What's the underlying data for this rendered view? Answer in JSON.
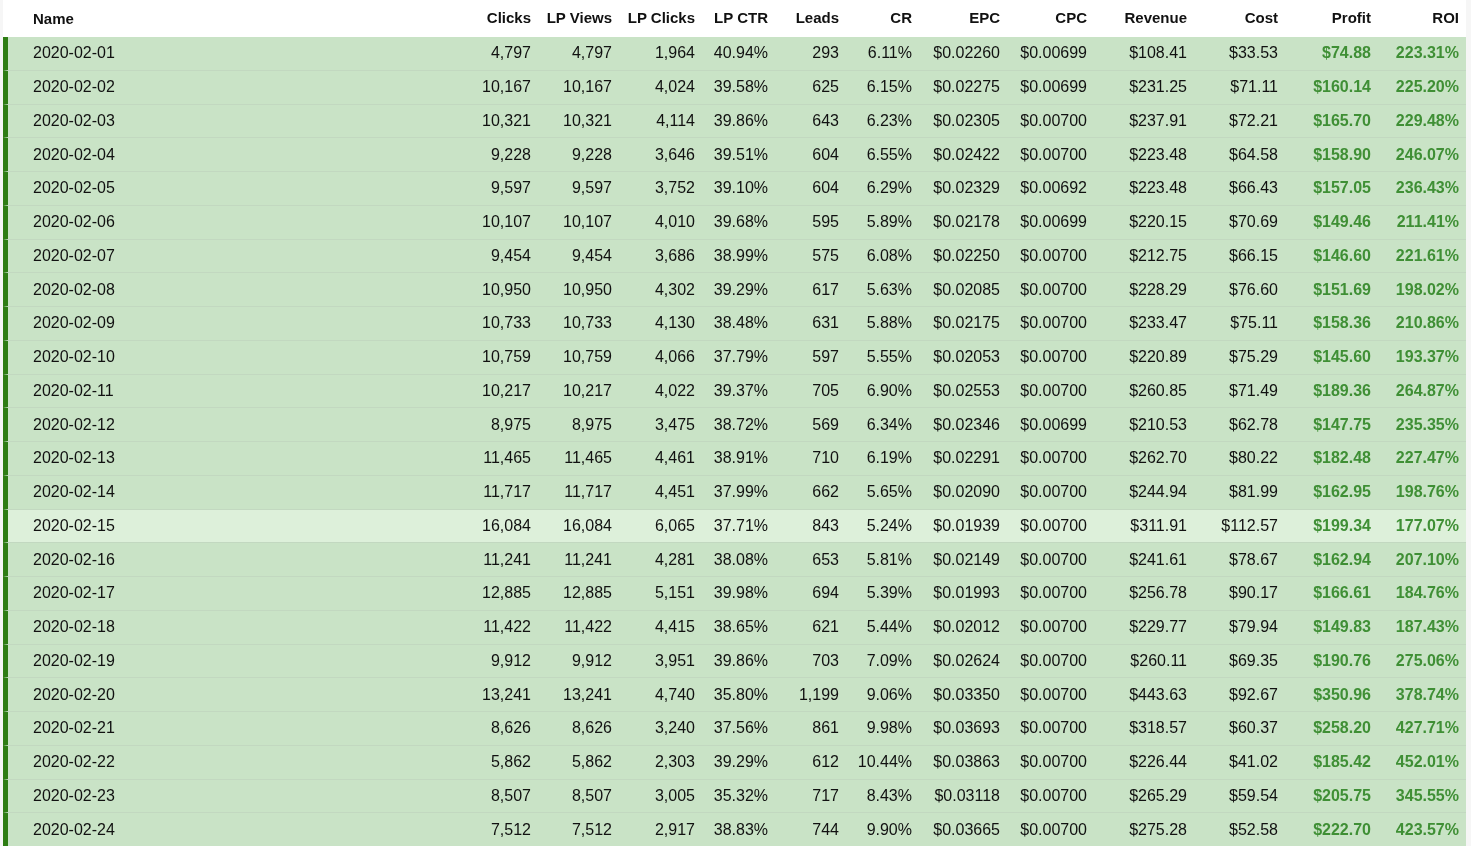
{
  "table": {
    "columns": [
      "Name",
      "Clicks",
      "LP Views",
      "LP Clicks",
      "LP CTR",
      "Leads",
      "CR",
      "EPC",
      "CPC",
      "Revenue",
      "Cost",
      "Profit",
      "ROI"
    ],
    "rows": [
      {
        "hovered": false,
        "cells": [
          "2020-02-01",
          "4,797",
          "4,797",
          "1,964",
          "40.94%",
          "293",
          "6.11%",
          "$0.02260",
          "$0.00699",
          "$108.41",
          "$33.53",
          "$74.88",
          "223.31%"
        ]
      },
      {
        "hovered": false,
        "cells": [
          "2020-02-02",
          "10,167",
          "10,167",
          "4,024",
          "39.58%",
          "625",
          "6.15%",
          "$0.02275",
          "$0.00699",
          "$231.25",
          "$71.11",
          "$160.14",
          "225.20%"
        ]
      },
      {
        "hovered": false,
        "cells": [
          "2020-02-03",
          "10,321",
          "10,321",
          "4,114",
          "39.86%",
          "643",
          "6.23%",
          "$0.02305",
          "$0.00700",
          "$237.91",
          "$72.21",
          "$165.70",
          "229.48%"
        ]
      },
      {
        "hovered": false,
        "cells": [
          "2020-02-04",
          "9,228",
          "9,228",
          "3,646",
          "39.51%",
          "604",
          "6.55%",
          "$0.02422",
          "$0.00700",
          "$223.48",
          "$64.58",
          "$158.90",
          "246.07%"
        ]
      },
      {
        "hovered": false,
        "cells": [
          "2020-02-05",
          "9,597",
          "9,597",
          "3,752",
          "39.10%",
          "604",
          "6.29%",
          "$0.02329",
          "$0.00692",
          "$223.48",
          "$66.43",
          "$157.05",
          "236.43%"
        ]
      },
      {
        "hovered": false,
        "cells": [
          "2020-02-06",
          "10,107",
          "10,107",
          "4,010",
          "39.68%",
          "595",
          "5.89%",
          "$0.02178",
          "$0.00699",
          "$220.15",
          "$70.69",
          "$149.46",
          "211.41%"
        ]
      },
      {
        "hovered": false,
        "cells": [
          "2020-02-07",
          "9,454",
          "9,454",
          "3,686",
          "38.99%",
          "575",
          "6.08%",
          "$0.02250",
          "$0.00700",
          "$212.75",
          "$66.15",
          "$146.60",
          "221.61%"
        ]
      },
      {
        "hovered": false,
        "cells": [
          "2020-02-08",
          "10,950",
          "10,950",
          "4,302",
          "39.29%",
          "617",
          "5.63%",
          "$0.02085",
          "$0.00700",
          "$228.29",
          "$76.60",
          "$151.69",
          "198.02%"
        ]
      },
      {
        "hovered": false,
        "cells": [
          "2020-02-09",
          "10,733",
          "10,733",
          "4,130",
          "38.48%",
          "631",
          "5.88%",
          "$0.02175",
          "$0.00700",
          "$233.47",
          "$75.11",
          "$158.36",
          "210.86%"
        ]
      },
      {
        "hovered": false,
        "cells": [
          "2020-02-10",
          "10,759",
          "10,759",
          "4,066",
          "37.79%",
          "597",
          "5.55%",
          "$0.02053",
          "$0.00700",
          "$220.89",
          "$75.29",
          "$145.60",
          "193.37%"
        ]
      },
      {
        "hovered": false,
        "cells": [
          "2020-02-11",
          "10,217",
          "10,217",
          "4,022",
          "39.37%",
          "705",
          "6.90%",
          "$0.02553",
          "$0.00700",
          "$260.85",
          "$71.49",
          "$189.36",
          "264.87%"
        ]
      },
      {
        "hovered": false,
        "cells": [
          "2020-02-12",
          "8,975",
          "8,975",
          "3,475",
          "38.72%",
          "569",
          "6.34%",
          "$0.02346",
          "$0.00699",
          "$210.53",
          "$62.78",
          "$147.75",
          "235.35%"
        ]
      },
      {
        "hovered": false,
        "cells": [
          "2020-02-13",
          "11,465",
          "11,465",
          "4,461",
          "38.91%",
          "710",
          "6.19%",
          "$0.02291",
          "$0.00700",
          "$262.70",
          "$80.22",
          "$182.48",
          "227.47%"
        ]
      },
      {
        "hovered": false,
        "cells": [
          "2020-02-14",
          "11,717",
          "11,717",
          "4,451",
          "37.99%",
          "662",
          "5.65%",
          "$0.02090",
          "$0.00700",
          "$244.94",
          "$81.99",
          "$162.95",
          "198.76%"
        ]
      },
      {
        "hovered": true,
        "cells": [
          "2020-02-15",
          "16,084",
          "16,084",
          "6,065",
          "37.71%",
          "843",
          "5.24%",
          "$0.01939",
          "$0.00700",
          "$311.91",
          "$112.57",
          "$199.34",
          "177.07%"
        ]
      },
      {
        "hovered": false,
        "cells": [
          "2020-02-16",
          "11,241",
          "11,241",
          "4,281",
          "38.08%",
          "653",
          "5.81%",
          "$0.02149",
          "$0.00700",
          "$241.61",
          "$78.67",
          "$162.94",
          "207.10%"
        ]
      },
      {
        "hovered": false,
        "cells": [
          "2020-02-17",
          "12,885",
          "12,885",
          "5,151",
          "39.98%",
          "694",
          "5.39%",
          "$0.01993",
          "$0.00700",
          "$256.78",
          "$90.17",
          "$166.61",
          "184.76%"
        ]
      },
      {
        "hovered": false,
        "cells": [
          "2020-02-18",
          "11,422",
          "11,422",
          "4,415",
          "38.65%",
          "621",
          "5.44%",
          "$0.02012",
          "$0.00700",
          "$229.77",
          "$79.94",
          "$149.83",
          "187.43%"
        ]
      },
      {
        "hovered": false,
        "cells": [
          "2020-02-19",
          "9,912",
          "9,912",
          "3,951",
          "39.86%",
          "703",
          "7.09%",
          "$0.02624",
          "$0.00700",
          "$260.11",
          "$69.35",
          "$190.76",
          "275.06%"
        ]
      },
      {
        "hovered": false,
        "cells": [
          "2020-02-20",
          "13,241",
          "13,241",
          "4,740",
          "35.80%",
          "1,199",
          "9.06%",
          "$0.03350",
          "$0.00700",
          "$443.63",
          "$92.67",
          "$350.96",
          "378.74%"
        ]
      },
      {
        "hovered": false,
        "cells": [
          "2020-02-21",
          "8,626",
          "8,626",
          "3,240",
          "37.56%",
          "861",
          "9.98%",
          "$0.03693",
          "$0.00700",
          "$318.57",
          "$60.37",
          "$258.20",
          "427.71%"
        ]
      },
      {
        "hovered": false,
        "cells": [
          "2020-02-22",
          "5,862",
          "5,862",
          "2,303",
          "39.29%",
          "612",
          "10.44%",
          "$0.03863",
          "$0.00700",
          "$226.44",
          "$41.02",
          "$185.42",
          "452.01%"
        ]
      },
      {
        "hovered": false,
        "cells": [
          "2020-02-23",
          "8,507",
          "8,507",
          "3,005",
          "35.32%",
          "717",
          "8.43%",
          "$0.03118",
          "$0.00700",
          "$265.29",
          "$59.54",
          "$205.75",
          "345.55%"
        ]
      },
      {
        "hovered": false,
        "cells": [
          "2020-02-24",
          "7,512",
          "7,512",
          "2,917",
          "38.83%",
          "744",
          "9.90%",
          "$0.03665",
          "$0.00700",
          "$275.28",
          "$52.58",
          "$222.70",
          "423.57%"
        ]
      }
    ]
  }
}
